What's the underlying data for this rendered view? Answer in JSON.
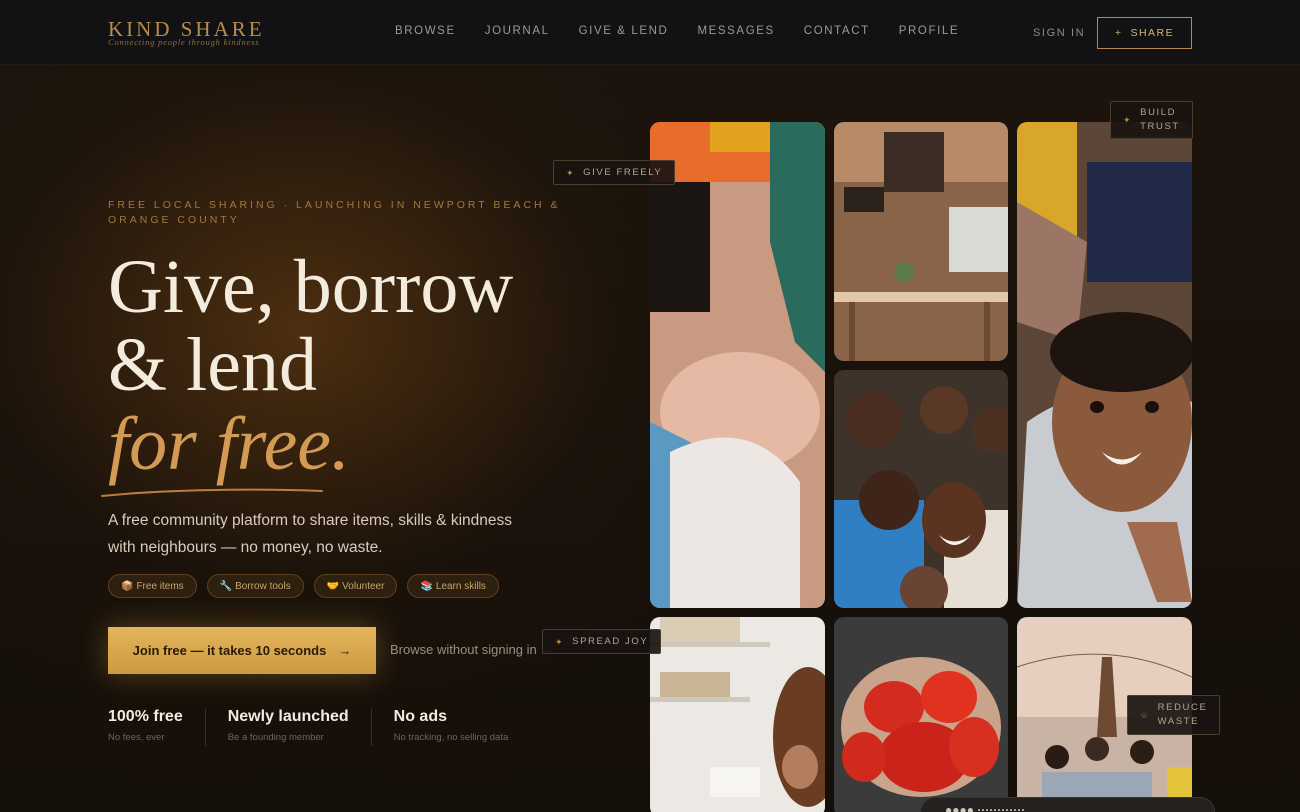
{
  "brand": {
    "title": "KIND SHARE",
    "tagline": "Connecting people through kindness"
  },
  "nav": {
    "links": [
      "BROWSE",
      "JOURNAL",
      "GIVE & LEND",
      "MESSAGES",
      "CONTACT",
      "PROFILE"
    ],
    "sign_in": "SIGN IN",
    "share_label": "SHARE",
    "share_icon": "+"
  },
  "hero": {
    "eyebrow": "FREE LOCAL SHARING · LAUNCHING IN NEWPORT BEACH & ORANGE COUNTY",
    "headline_line1": "Give, borrow",
    "headline_line2": "& lend",
    "headline_accent": "for free.",
    "lede": "A free community platform to share items, skills & kindness with neighbours — no money, no waste.",
    "chips": [
      {
        "icon": "📦",
        "label": "Free items"
      },
      {
        "icon": "🔧",
        "label": "Borrow tools"
      },
      {
        "icon": "🤝",
        "label": "Volunteer"
      },
      {
        "icon": "📚",
        "label": "Learn skills"
      }
    ],
    "cta_label": "Join free — it takes 10 seconds",
    "cta_arrow": "→",
    "browse_label": "Browse without signing in →"
  },
  "stats": [
    {
      "value": "100% free",
      "label": "No fees, ever"
    },
    {
      "value": "Newly launched",
      "label": "Be a founding member"
    },
    {
      "value": "No ads",
      "label": "No tracking, no selling data"
    }
  ],
  "tags": {
    "give_freely": "GIVE FREELY",
    "build_trust_1": "BUILD",
    "build_trust_2": "TRUST",
    "spread_joy": "SPREAD JOY",
    "reduce_waste_1": "REDUCE",
    "reduce_waste_2": "WASTE"
  },
  "toast": {
    "text": "●●●● ············"
  },
  "colors": {
    "accent": "#d39a55",
    "cta": "#e3b55a",
    "nav_bg": "#121214"
  }
}
